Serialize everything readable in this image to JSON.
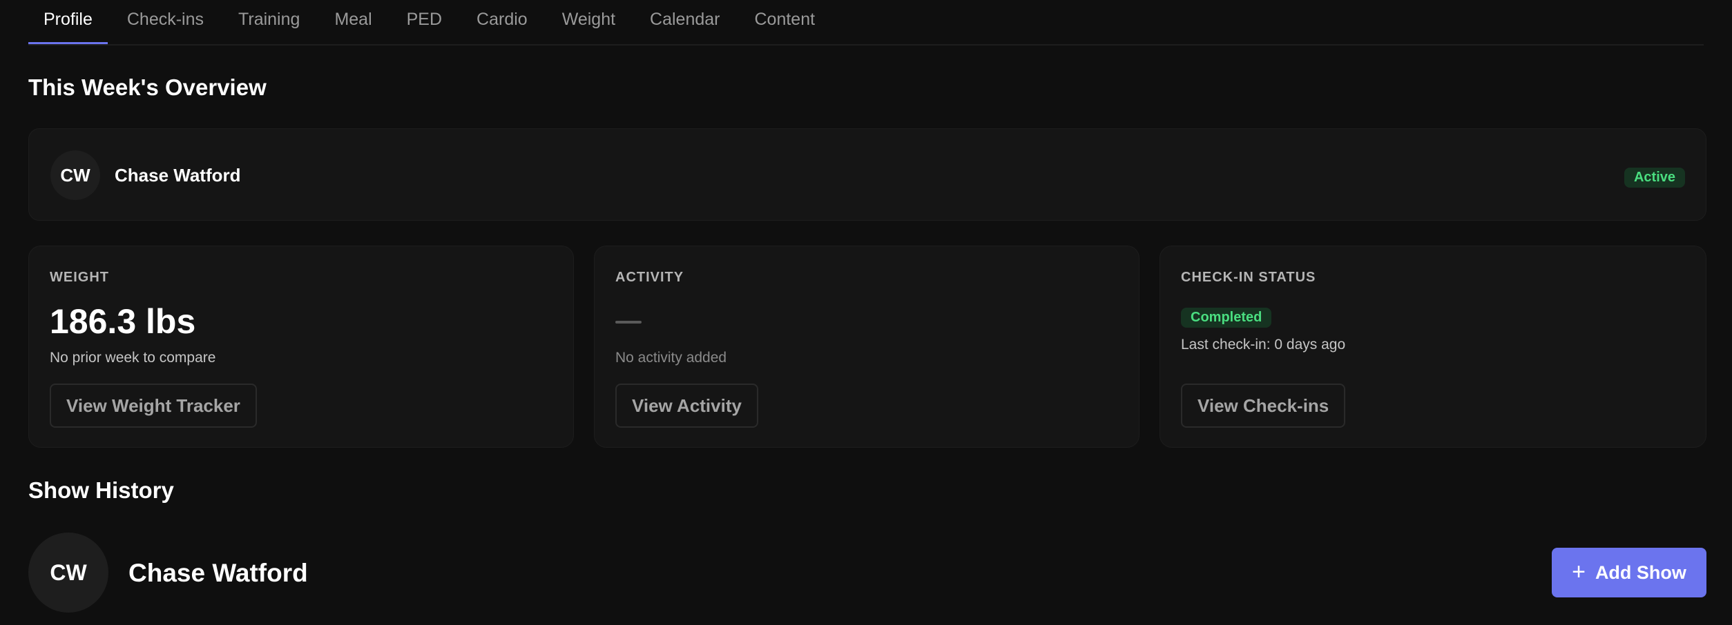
{
  "tabs": [
    {
      "label": "Profile",
      "active": true
    },
    {
      "label": "Check-ins",
      "active": false
    },
    {
      "label": "Training",
      "active": false
    },
    {
      "label": "Meal",
      "active": false
    },
    {
      "label": "PED",
      "active": false
    },
    {
      "label": "Cardio",
      "active": false
    },
    {
      "label": "Weight",
      "active": false
    },
    {
      "label": "Calendar",
      "active": false
    },
    {
      "label": "Content",
      "active": false
    }
  ],
  "overview": {
    "title": "This Week's Overview",
    "client": {
      "initials": "CW",
      "name": "Chase Watford",
      "status": "Active"
    }
  },
  "stats": {
    "weight": {
      "title": "WEIGHT",
      "value": "186.3 lbs",
      "note": "No prior week to compare",
      "button": "View Weight Tracker"
    },
    "activity": {
      "title": "ACTIVITY",
      "note": "No activity added",
      "button": "View Activity"
    },
    "checkin": {
      "title": "CHECK-IN STATUS",
      "status": "Completed",
      "note": "Last check-in: 0 days ago",
      "button": "View Check-ins"
    }
  },
  "show_history": {
    "title": "Show History",
    "initials": "CW",
    "name": "Chase Watford",
    "add_button": "Add Show",
    "add_icon": "plus-icon"
  },
  "colors": {
    "accent": "#6b74ee",
    "success": "#4ade80",
    "background": "#0f0f0f",
    "card": "#151515"
  }
}
